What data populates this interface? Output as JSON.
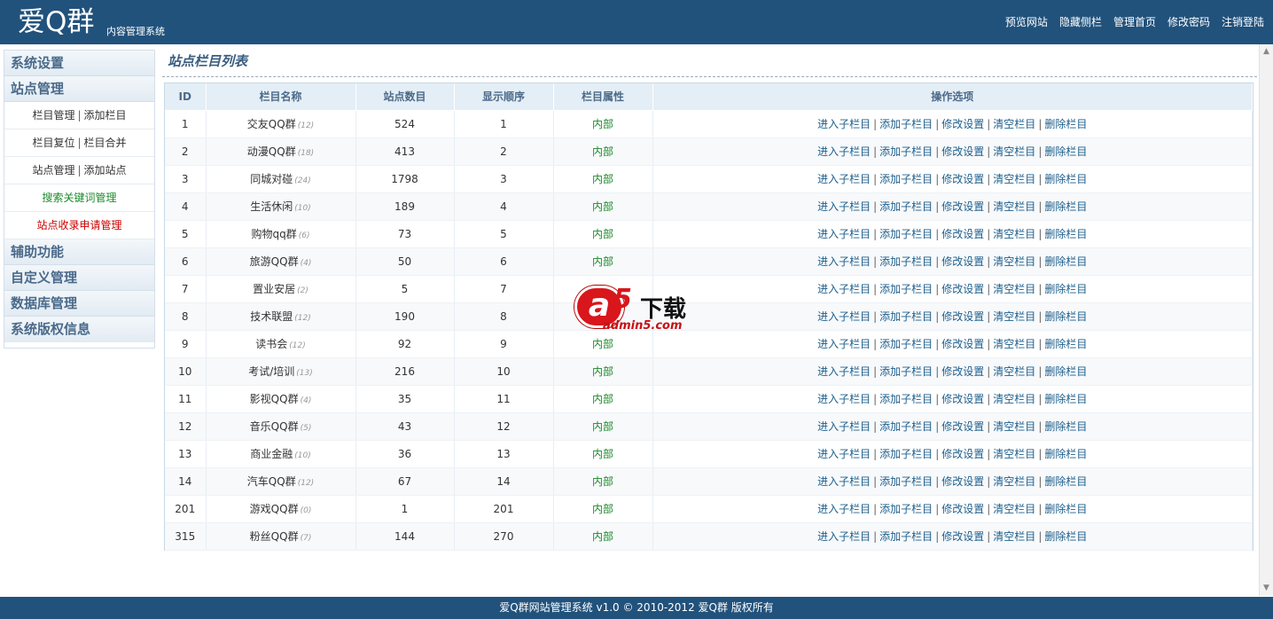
{
  "header": {
    "logo": "爱Q群",
    "subtitle": "内容管理系统",
    "nav": [
      "预览网站",
      "隐藏侧栏",
      "管理首页",
      "修改密码",
      "注销登陆"
    ]
  },
  "sidebar": {
    "sections": [
      {
        "title": "系统设置"
      },
      {
        "title": "站点管理",
        "items": [
          {
            "a": "栏目管理",
            "b": "添加栏目",
            "style": "normal"
          },
          {
            "a": "栏目复位",
            "b": "栏目合并",
            "style": "normal"
          },
          {
            "a": "站点管理",
            "b": "添加站点",
            "style": "normal"
          },
          {
            "a": "搜索关键词管理",
            "style": "green"
          },
          {
            "a": "站点收录申请管理",
            "style": "red"
          }
        ]
      },
      {
        "title": "辅助功能"
      },
      {
        "title": "自定义管理"
      },
      {
        "title": "数据库管理"
      },
      {
        "title": "系统版权信息"
      }
    ]
  },
  "main": {
    "title": "站点栏目列表",
    "columns": [
      "ID",
      "栏目名称",
      "站点数目",
      "显示顺序",
      "栏目属性",
      "操作选项"
    ],
    "ops": [
      "进入子栏目",
      "添加子栏目",
      "修改设置",
      "清空栏目",
      "删除栏目"
    ],
    "rows": [
      {
        "id": "1",
        "name": "交友QQ群",
        "sub": "(12)",
        "count": "524",
        "order": "1",
        "attr": "内部"
      },
      {
        "id": "2",
        "name": "动漫QQ群",
        "sub": "(18)",
        "count": "413",
        "order": "2",
        "attr": "内部"
      },
      {
        "id": "3",
        "name": "同城对碰",
        "sub": "(24)",
        "count": "1798",
        "order": "3",
        "attr": "内部"
      },
      {
        "id": "4",
        "name": "生活休闲",
        "sub": "(10)",
        "count": "189",
        "order": "4",
        "attr": "内部"
      },
      {
        "id": "5",
        "name": "购物qq群",
        "sub": "(6)",
        "count": "73",
        "order": "5",
        "attr": "内部"
      },
      {
        "id": "6",
        "name": "旅游QQ群",
        "sub": "(4)",
        "count": "50",
        "order": "6",
        "attr": "内部"
      },
      {
        "id": "7",
        "name": "置业安居",
        "sub": "(2)",
        "count": "5",
        "order": "7",
        "attr": ""
      },
      {
        "id": "8",
        "name": "技术联盟",
        "sub": "(12)",
        "count": "190",
        "order": "8",
        "attr": ""
      },
      {
        "id": "9",
        "name": "读书会",
        "sub": "(12)",
        "count": "92",
        "order": "9",
        "attr": "内部"
      },
      {
        "id": "10",
        "name": "考试/培训",
        "sub": "(13)",
        "count": "216",
        "order": "10",
        "attr": "内部"
      },
      {
        "id": "11",
        "name": "影视QQ群",
        "sub": "(4)",
        "count": "35",
        "order": "11",
        "attr": "内部"
      },
      {
        "id": "12",
        "name": "音乐QQ群",
        "sub": "(5)",
        "count": "43",
        "order": "12",
        "attr": "内部"
      },
      {
        "id": "13",
        "name": "商业金融",
        "sub": "(10)",
        "count": "36",
        "order": "13",
        "attr": "内部"
      },
      {
        "id": "14",
        "name": "汽车QQ群",
        "sub": "(12)",
        "count": "67",
        "order": "14",
        "attr": "内部"
      },
      {
        "id": "201",
        "name": "游戏QQ群",
        "sub": "(0)",
        "count": "1",
        "order": "201",
        "attr": "内部"
      },
      {
        "id": "315",
        "name": "粉丝QQ群",
        "sub": "(7)",
        "count": "144",
        "order": "270",
        "attr": "内部"
      }
    ]
  },
  "watermark": {
    "a": "a",
    "five": "5",
    "dl": "下载",
    "url": "admin5.com"
  },
  "footer": "爱Q群网站管理系统 v1.0 © 2010-2012 爱Q群 版权所有",
  "colors": {
    "header_bg": "#21527c",
    "attr_green": "#1b8a2a",
    "link_blue": "#1e5f8c",
    "red": "#cc0000"
  }
}
